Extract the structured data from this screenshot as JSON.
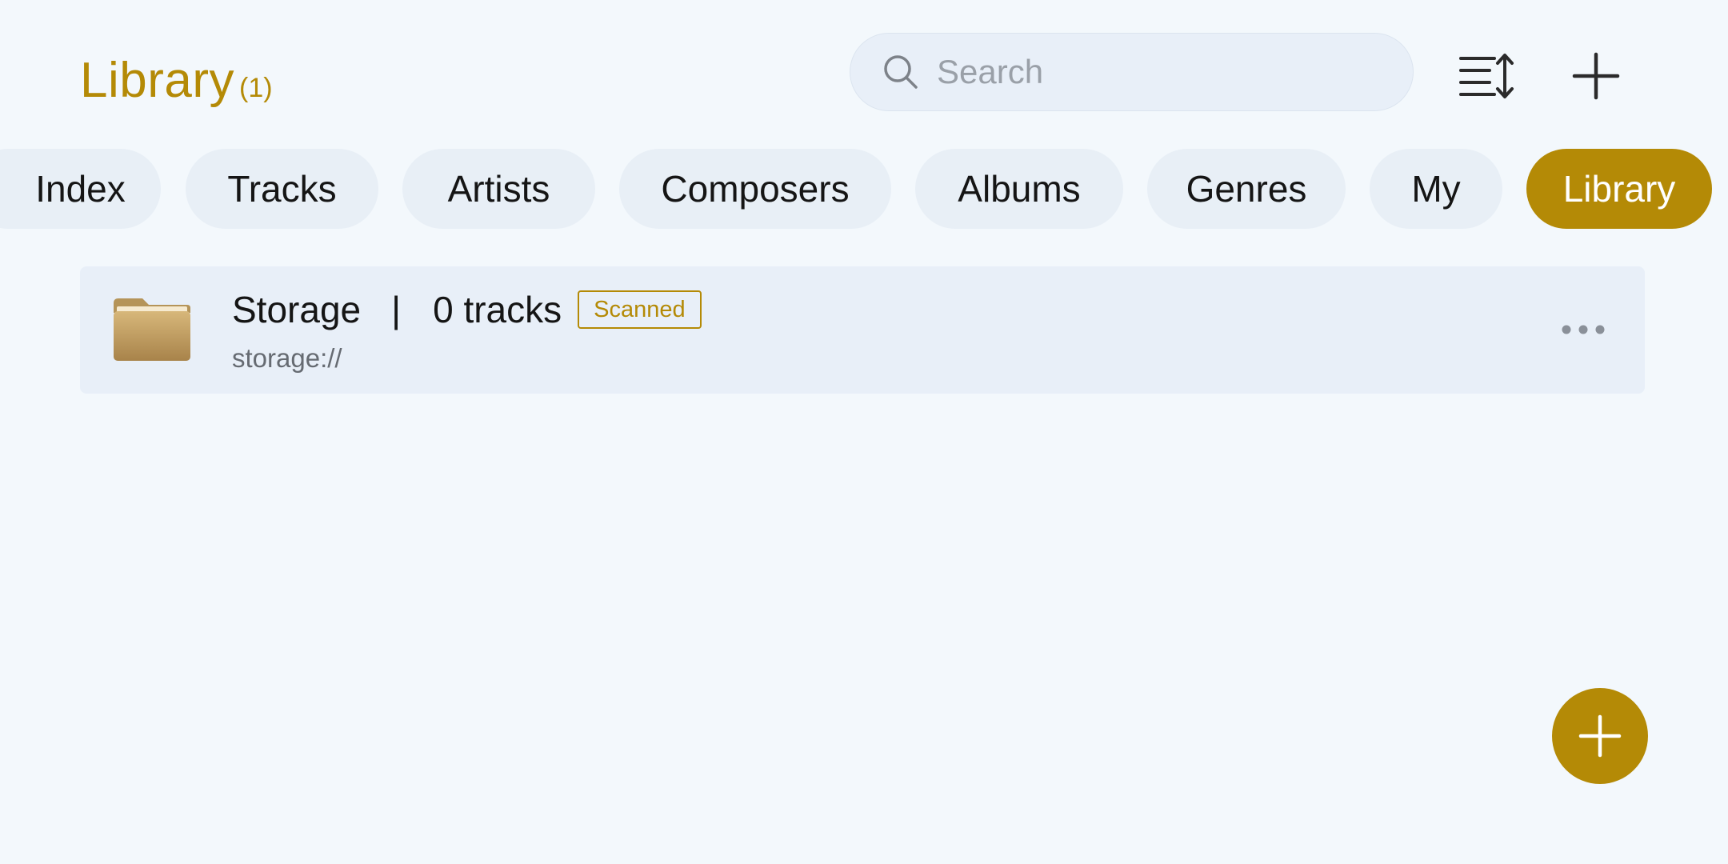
{
  "header": {
    "title": "Library",
    "count": "(1)",
    "search_placeholder": "Search"
  },
  "tabs": [
    {
      "label": "Index"
    },
    {
      "label": "Tracks"
    },
    {
      "label": "Artists"
    },
    {
      "label": "Composers"
    },
    {
      "label": "Albums"
    },
    {
      "label": "Genres"
    },
    {
      "label": "My"
    },
    {
      "label": "Library",
      "active": true
    }
  ],
  "library": {
    "items": [
      {
        "name": "Storage",
        "separator": "|",
        "tracks": "0 tracks",
        "badge": "Scanned",
        "path": "storage://"
      }
    ]
  },
  "icons": {
    "search": "search-icon",
    "sort": "sort-icon",
    "add": "plus-icon",
    "folder": "folder-icon",
    "more": "more-horizontal-icon",
    "fab": "plus-icon"
  },
  "colors": {
    "accent": "#b48a06",
    "background": "#f3f8fc",
    "surface": "#e8eff8"
  }
}
